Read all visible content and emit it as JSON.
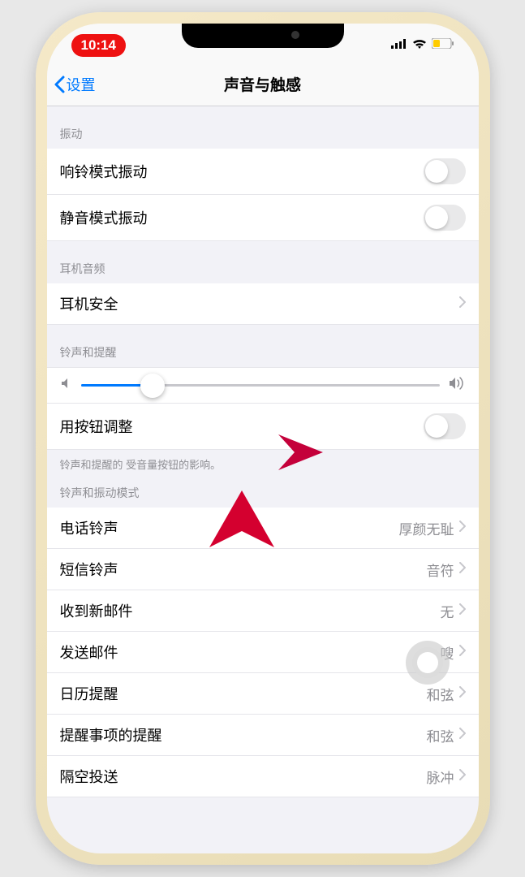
{
  "status": {
    "time": "10:14"
  },
  "nav": {
    "back": "设置",
    "title": "声音与触感"
  },
  "sections": {
    "vibration": {
      "header": "振动",
      "ring": "响铃模式振动",
      "silent": "静音模式振动"
    },
    "headphone": {
      "header": "耳机音频",
      "safety": "耳机安全"
    },
    "ringer": {
      "header": "铃声和提醒",
      "buttonToggle": "用按钮调整",
      "footer": "铃声和提醒的            受音量按钮的影响。"
    },
    "sounds": {
      "header": "铃声和振动模式",
      "ringtone": {
        "label": "电话铃声",
        "value": "厚颜无耻"
      },
      "text": {
        "label": "短信铃声",
        "value": "音符"
      },
      "mail": {
        "label": "收到新邮件",
        "value": "无"
      },
      "sent": {
        "label": "发送邮件",
        "value": "嗖"
      },
      "calendar": {
        "label": "日历提醒",
        "value": "和弦"
      },
      "reminder": {
        "label": "提醒事项的提醒",
        "value": "和弦"
      },
      "airdrop": {
        "label": "隔空投送",
        "value": "脉冲"
      }
    }
  }
}
